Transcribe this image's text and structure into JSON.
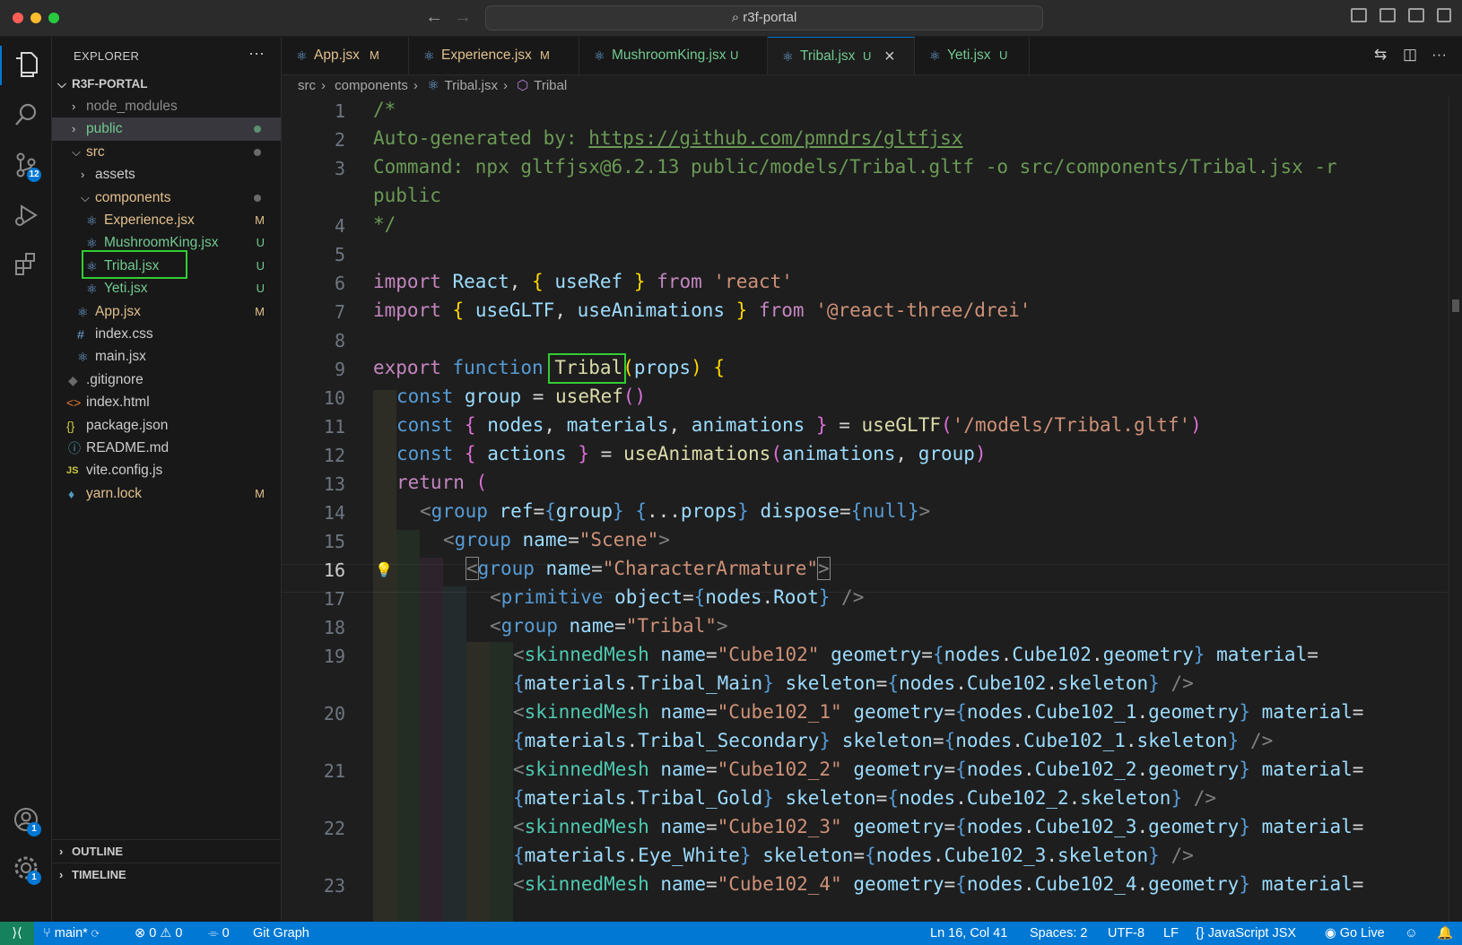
{
  "window": {
    "title": "r3f-portal"
  },
  "explorer": {
    "title": "EXPLORER",
    "root": "R3F-PORTAL",
    "items": [
      {
        "label": "node_modules",
        "status": ""
      },
      {
        "label": "public",
        "status": ""
      },
      {
        "label": "src",
        "status": ""
      },
      {
        "label": "assets",
        "status": ""
      },
      {
        "label": "components",
        "status": ""
      },
      {
        "label": "Experience.jsx",
        "status": "M"
      },
      {
        "label": "MushroomKing.jsx",
        "status": "U"
      },
      {
        "label": "Tribal.jsx",
        "status": "U"
      },
      {
        "label": "Yeti.jsx",
        "status": "U"
      },
      {
        "label": "App.jsx",
        "status": "M"
      },
      {
        "label": "index.css",
        "status": ""
      },
      {
        "label": "main.jsx",
        "status": ""
      },
      {
        "label": ".gitignore",
        "status": ""
      },
      {
        "label": "index.html",
        "status": ""
      },
      {
        "label": "package.json",
        "status": ""
      },
      {
        "label": "README.md",
        "status": ""
      },
      {
        "label": "vite.config.js",
        "status": ""
      },
      {
        "label": "yarn.lock",
        "status": "M"
      }
    ],
    "outline": "OUTLINE",
    "timeline": "TIMELINE"
  },
  "activity": {
    "scm_badge": "12",
    "accounts_badge": "1",
    "settings_badge": "1"
  },
  "tabs": [
    {
      "label": "App.jsx",
      "status": "M"
    },
    {
      "label": "Experience.jsx",
      "status": "M"
    },
    {
      "label": "MushroomKing.jsx",
      "status": "U"
    },
    {
      "label": "Tribal.jsx",
      "status": "U",
      "close": "×"
    },
    {
      "label": "Yeti.jsx",
      "status": "U"
    }
  ],
  "breadcrumb": [
    "src",
    "components",
    "Tribal.jsx",
    "Tribal"
  ],
  "editor": {
    "line_numbers": [
      "1",
      "2",
      "3",
      "",
      "4",
      "5",
      "6",
      "7",
      "8",
      "9",
      "10",
      "11",
      "12",
      "13",
      "14",
      "15",
      "16",
      "17",
      "18",
      "19",
      "",
      "20",
      "",
      "21",
      "",
      "22",
      "",
      "23"
    ],
    "current_line": "16"
  },
  "status": {
    "branch": "main*",
    "errors": "0",
    "warnings": "0",
    "ports": "0",
    "git_graph": "Git Graph",
    "position": "Ln 16, Col 41",
    "spaces": "Spaces: 2",
    "encoding": "UTF-8",
    "eol": "LF",
    "language": "JavaScript JSX",
    "golive": "Go Live"
  },
  "colors": {
    "accent": "#0078d4",
    "modified": "#e2c08d",
    "untracked": "#73c991",
    "highlight_box": "#33cc33"
  }
}
